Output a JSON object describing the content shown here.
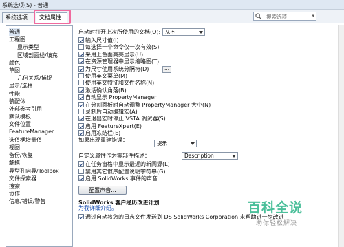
{
  "window": {
    "title": "系统选项(S) - 普通"
  },
  "tabs": [
    {
      "label": "系统选项(S)"
    },
    {
      "label": "文档属性(D)"
    }
  ],
  "search": {
    "placeholder": "搜索选项"
  },
  "tree": [
    {
      "label": "普通",
      "level": 0,
      "selected": true
    },
    {
      "label": "工程图",
      "level": 0
    },
    {
      "label": "显示类型",
      "level": 1
    },
    {
      "label": "区域剖面线/填充",
      "level": 1
    },
    {
      "label": "颜色",
      "level": 0
    },
    {
      "label": "草图",
      "level": 0
    },
    {
      "label": "几何关系/捕捉",
      "level": 1
    },
    {
      "label": "显示/选择",
      "level": 0
    },
    {
      "label": "性能",
      "level": 0
    },
    {
      "label": "装配体",
      "level": 0
    },
    {
      "label": "外部参考引用",
      "level": 0
    },
    {
      "label": "默认模板",
      "level": 0
    },
    {
      "label": "文件位置",
      "level": 0
    },
    {
      "label": "FeatureManager",
      "level": 0
    },
    {
      "label": "选值框增量值",
      "level": 0
    },
    {
      "label": "视图",
      "level": 0
    },
    {
      "label": "备份/恢复",
      "level": 0
    },
    {
      "label": "触摸",
      "level": 0
    },
    {
      "label": "异型孔向导/Toolbox",
      "level": 0
    },
    {
      "label": "文件探索器",
      "level": 0
    },
    {
      "label": "搜索",
      "level": 0
    },
    {
      "label": "协作",
      "level": 0
    },
    {
      "label": "信息/错误/警告",
      "level": 0
    }
  ],
  "main": {
    "open_last_label": "启动时打开上次所使用的文档(O):",
    "open_last_value": "从不",
    "checkboxes": [
      {
        "label": "输入尺寸值(I)",
        "checked": true
      },
      {
        "label": "每选择一个命令仅一次有效(S)",
        "checked": false
      },
      {
        "label": "采用上色面高亮显示(U)",
        "checked": true
      },
      {
        "label": "在资源管理器中显示缩略图(T)",
        "checked": true
      },
      {
        "label": "为尺寸使用系统分隔符(D)",
        "checked": true
      },
      {
        "label": "使用英文菜单(M)",
        "checked": false
      },
      {
        "label": "使用英文特征和文件名称(N)",
        "checked": false
      },
      {
        "label": "激活确认角落(B)",
        "checked": true
      },
      {
        "label": "自动显示 PropertyManager",
        "checked": true
      },
      {
        "label": "在分割面板时自动调整 PropertyManager 大小(N)",
        "checked": true
      },
      {
        "label": "录制后自动编辑宏(A)",
        "checked": false
      },
      {
        "label": "在退出宏时停止 VSTA 调试器(S)",
        "checked": true
      },
      {
        "label": "启用 FeatureXpert(E)",
        "checked": true
      },
      {
        "label": "启用冻结栏(E)",
        "checked": true
      }
    ],
    "rebuild_error_label": "如果出现重建错误：",
    "rebuild_error_value": "提示",
    "custom_prop_label": "自定义属性作为零部件描述：",
    "custom_prop_value": "Description",
    "checkboxes2": [
      {
        "label": "在任务窗格中显示最近的新闻源(L)",
        "checked": true
      },
      {
        "label": "禁用其它惯序配置说明字符串(G)",
        "checked": false
      },
      {
        "label": "启用 SolidWorks 事件的声音",
        "checked": true
      }
    ],
    "sound_button": "配置声音...",
    "experience_title": "SolidWorks 客户经历改进计划",
    "more_link": "为我详细介绍。",
    "last_checkbox": {
      "label": "通过自动将您的日志文件发送到 DS SolidWorks Corporation 来帮助进一步改进",
      "checked": true
    }
  },
  "watermark": {
    "big": "百科全说",
    "small": "助你轻松解决"
  }
}
